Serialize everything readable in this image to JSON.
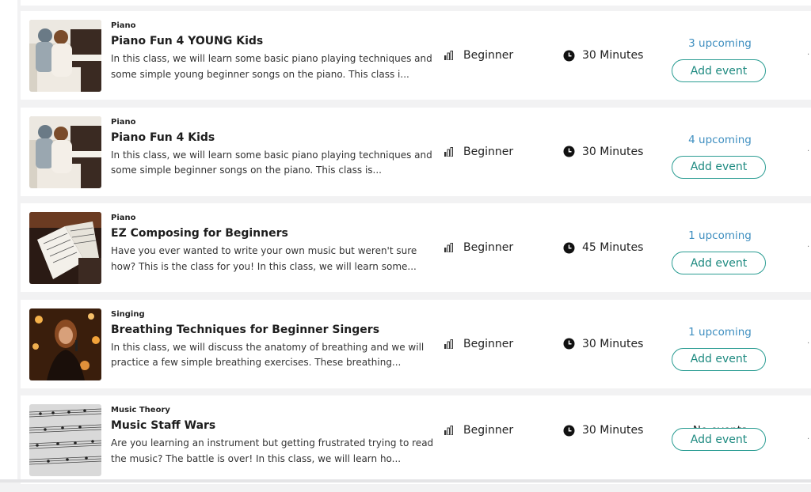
{
  "colors": {
    "accent": "#2b9d93",
    "link": "#3f8fc0"
  },
  "classes": [
    {
      "category": "Piano",
      "title": "Piano Fun 4 YOUNG Kids",
      "description": "In this class, we will learn some basic piano playing techniques and some simple young beginner songs on the piano. This class i...",
      "level": "Beginner",
      "duration": "30 Minutes",
      "events": "3 upcoming",
      "add_label": "Add event",
      "image_icon": "piano-kids-photo"
    },
    {
      "category": "Piano",
      "title": "Piano Fun 4 Kids",
      "description": "In this class, we will learn some basic piano playing techniques and some simple beginner songs on the piano. This class is...",
      "level": "Beginner",
      "duration": "30 Minutes",
      "events": "4 upcoming",
      "add_label": "Add event",
      "image_icon": "piano-kids-photo"
    },
    {
      "category": "Piano",
      "title": "EZ Composing for Beginners",
      "description": "Have you ever wanted to write your own music but weren't sure how? This is the class for you! In this class, we will learn some...",
      "level": "Beginner",
      "duration": "45 Minutes",
      "events": "1 upcoming",
      "add_label": "Add event",
      "image_icon": "sheet-music-photo"
    },
    {
      "category": "Singing",
      "title": "Breathing Techniques for Beginner Singers",
      "description": "In this class, we will discuss the anatomy of breathing and we will practice a few simple breathing exercises. These breathing...",
      "level": "Beginner",
      "duration": "30 Minutes",
      "events": "1 upcoming",
      "add_label": "Add event",
      "image_icon": "singer-photo"
    },
    {
      "category": "Music Theory",
      "title": "Music Staff Wars",
      "description": "Are you learning an instrument but getting frustrated trying to read the music? The battle is over! In this class, we will learn ho...",
      "level": "Beginner",
      "duration": "30 Minutes",
      "events": "No events",
      "add_label": "Add event",
      "image_icon": "music-staff-photo"
    }
  ]
}
